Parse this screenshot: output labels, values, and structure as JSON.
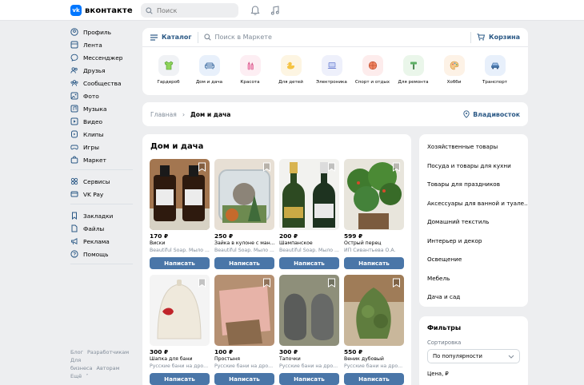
{
  "header": {
    "logo_letter": "vk",
    "logo_text": "вконтакте",
    "search_placeholder": "Поиск"
  },
  "sidebar": {
    "group1": [
      "Профиль",
      "Лента",
      "Мессенджер",
      "Друзья",
      "Сообщества",
      "Фото",
      "Музыка",
      "Видео",
      "Клипы",
      "Игры",
      "Маркет"
    ],
    "group2": [
      "Сервисы",
      "VK Pay"
    ],
    "group3": [
      "Закладки",
      "Файлы",
      "Реклама",
      "Помощь"
    ],
    "footer": [
      "Блог",
      "Разработчикам",
      "Для бизнеса",
      "Авторам",
      "Ещё"
    ]
  },
  "market": {
    "catalog_label": "Каталог",
    "search_placeholder": "Поиск в Маркете",
    "cart_label": "Корзина",
    "categories": [
      "Гардероб",
      "Дом и дача",
      "Красота",
      "Для детей",
      "Электроника",
      "Спорт и отдых",
      "Для ремонта",
      "Хобби",
      "Транспорт"
    ]
  },
  "breadcrumb": {
    "home": "Главная",
    "current": "Дом и дача",
    "city": "Владивосток"
  },
  "products": {
    "title": "Дом и дача",
    "button_label": "Написать",
    "items": [
      {
        "price": "170 ₽",
        "name": "Виски",
        "seller": "Beautiful Soap. Мыло ..."
      },
      {
        "price": "250 ₽",
        "name": "Зайка в кулоне с ман...",
        "seller": "Beautiful Soap. Мыло ..."
      },
      {
        "price": "200 ₽",
        "name": "Шампанское",
        "seller": "Beautiful Soap. Мыло ..."
      },
      {
        "price": "599 ₽",
        "name": "Острый перец",
        "seller": "ИП Сивантьева О.А."
      },
      {
        "price": "300 ₽",
        "name": "Шапка для бани",
        "seller": "Русские бани на дро..."
      },
      {
        "price": "100 ₽",
        "name": "Простыня",
        "seller": "Русские бани на дро..."
      },
      {
        "price": "300 ₽",
        "name": "Тапочки",
        "seller": "Русские бани на дро..."
      },
      {
        "price": "550 ₽",
        "name": "Веник дубовый",
        "seller": "Русские бани на дро..."
      }
    ]
  },
  "subcategories": [
    "Хозяйственные товары",
    "Посуда и товары для кухни",
    "Товары для праздников",
    "Аксессуары для ванной и туале...",
    "Домашний текстиль",
    "Интерьер и декор",
    "Освещение",
    "Мебель",
    "Дача и сад"
  ],
  "filters": {
    "title": "Фильтры",
    "sort_label": "Сортировка",
    "sort_value": "По популярности",
    "price_label": "Цена, ₽"
  },
  "colors": {
    "accent": "#4a76a8",
    "link": "#2a5885",
    "vk_blue": "#0077ff",
    "background": "#edeef0"
  }
}
